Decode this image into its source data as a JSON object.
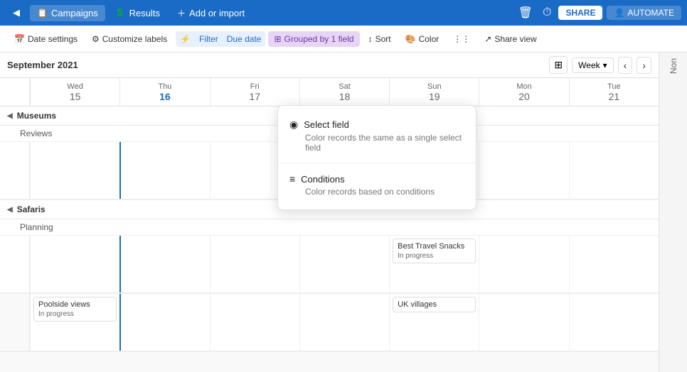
{
  "nav": {
    "tabs": [
      {
        "label": "Campaigns",
        "icon": "📋",
        "active": false
      },
      {
        "label": "Results",
        "icon": "💲",
        "active": false
      },
      {
        "label": "Add or import",
        "icon": "+",
        "active": false
      }
    ],
    "share_label": "SHARE",
    "automate_label": "AUTOMATE"
  },
  "toolbar": {
    "date_settings": "Date settings",
    "customize_labels": "Customize labels",
    "filter_label": "Filter",
    "due_date_label": "Due date",
    "grouped_label": "Grouped by 1 field",
    "sort_label": "Sort",
    "color_label": "Color",
    "share_view_label": "Share view"
  },
  "calendar": {
    "month": "September 2021",
    "view": "Week",
    "days": [
      {
        "name": "Wed",
        "num": "15",
        "today": false
      },
      {
        "name": "Thu",
        "num": "16",
        "today": true
      },
      {
        "name": "Fri",
        "num": "17",
        "today": false
      },
      {
        "name": "Sat",
        "num": "18",
        "today": false
      },
      {
        "name": "Sun",
        "num": "19",
        "today": false
      },
      {
        "name": "Mon",
        "num": "20",
        "today": false
      },
      {
        "name": "Tue",
        "num": "21",
        "today": false
      }
    ],
    "groups": [
      {
        "name": "Museums",
        "collapsed": false,
        "subrows": [
          {
            "name": "Reviews",
            "events": []
          }
        ]
      },
      {
        "name": "Safaris",
        "collapsed": false,
        "subrows": [
          {
            "name": "Planning",
            "events": [
              {
                "col": 4,
                "title": "Best Travel Snacks",
                "status": "In progress"
              }
            ]
          }
        ]
      }
    ],
    "poolside_row": {
      "events": [
        {
          "col": 0,
          "title": "Poolside views",
          "status": "In progress"
        },
        {
          "col": 4,
          "title": "UK villages",
          "status": ""
        }
      ]
    }
  },
  "dropdown": {
    "items": [
      {
        "icon": "◉",
        "title": "Select field",
        "description": "Color records the same as a single select field"
      },
      {
        "icon": "≡",
        "title": "Conditions",
        "description": "Color records based on conditions"
      }
    ]
  },
  "right_panel": {
    "label": "Non"
  }
}
